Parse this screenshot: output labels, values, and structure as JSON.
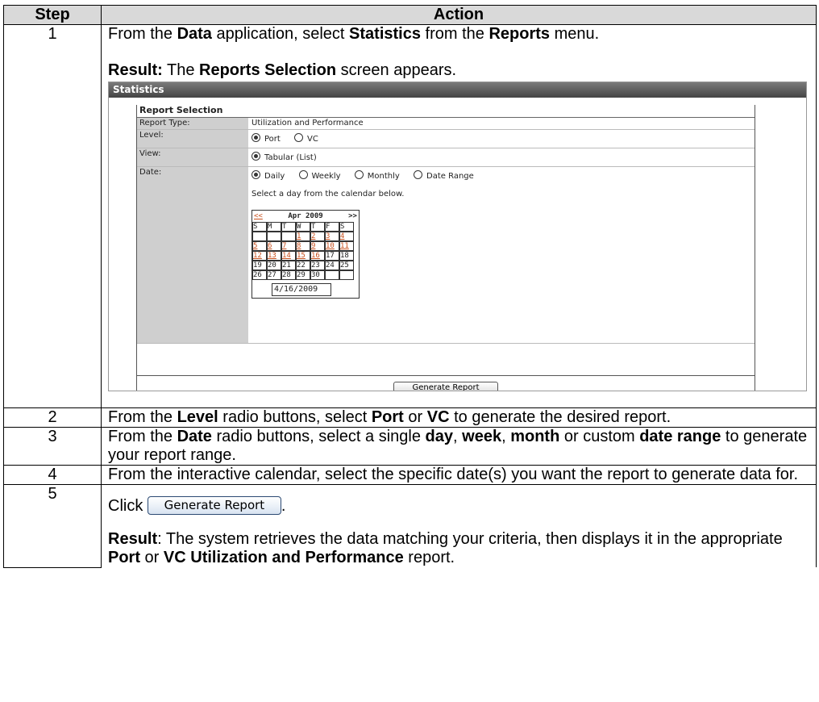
{
  "headers": {
    "step": "Step",
    "action": "Action"
  },
  "rows": [
    {
      "step": "1",
      "line1": [
        "From the ",
        "Data",
        " application, select ",
        "Statistics",
        " from the ",
        "Reports",
        " menu."
      ],
      "result": [
        "Result:",
        " The ",
        "Reports Selection",
        " screen appears."
      ]
    },
    {
      "step": "2",
      "text": [
        "From the ",
        "Level",
        " radio buttons, select ",
        "Port",
        " or ",
        "VC",
        " to generate the desired report."
      ]
    },
    {
      "step": "3",
      "text": [
        "From the ",
        "Date",
        " radio buttons, select a single ",
        "day",
        ", ",
        "week",
        ", ",
        "month",
        " or custom ",
        "date range",
        " to generate your report range."
      ]
    },
    {
      "step": "4",
      "text": "From the interactive calendar, select the specific date(s) you want the report to generate data for."
    },
    {
      "step": "5",
      "click": "Click",
      "button": "Generate Report",
      "period": ".",
      "result": [
        "Result",
        ":  The system retrieves the data matching your criteria, then displays it in the appropriate ",
        "Port",
        " or ",
        "VC Utilization and Performance",
        " report."
      ]
    }
  ],
  "screenshot": {
    "title": "Statistics",
    "section": "Report Selection",
    "fields": {
      "report_type": {
        "label": "Report Type:",
        "value": "Utilization and Performance"
      },
      "level": {
        "label": "Level:",
        "options": [
          "Port",
          "VC"
        ],
        "selected": "Port"
      },
      "view": {
        "label": "View:",
        "options": [
          "Tabular (List)"
        ],
        "selected": "Tabular (List)"
      },
      "date": {
        "label": "Date:",
        "options": [
          "Daily",
          "Weekly",
          "Monthly",
          "Date Range"
        ],
        "selected": "Daily",
        "hint": "Select a day from the calendar below."
      }
    },
    "calendar": {
      "prev": "<<",
      "month": "Apr 2009",
      "next": ">>",
      "weekdays": [
        "S",
        "M",
        "T",
        "W",
        "T",
        "F",
        "S"
      ],
      "weeks": [
        [
          "",
          "",
          "",
          "1",
          "2",
          "3",
          "4"
        ],
        [
          "5",
          "6",
          "7",
          "8",
          "9",
          "10",
          "11"
        ],
        [
          "12",
          "13",
          "14",
          "15",
          "16",
          "17",
          "18"
        ],
        [
          "19",
          "20",
          "21",
          "22",
          "23",
          "24",
          "25"
        ],
        [
          "26",
          "27",
          "28",
          "29",
          "30",
          "",
          ""
        ]
      ],
      "linked_days": [
        "1",
        "2",
        "3",
        "4",
        "5",
        "6",
        "7",
        "8",
        "9",
        "10",
        "11",
        "12",
        "13",
        "14",
        "15",
        "16"
      ],
      "selected_date": "4/16/2009"
    },
    "button": "Generate Report"
  }
}
